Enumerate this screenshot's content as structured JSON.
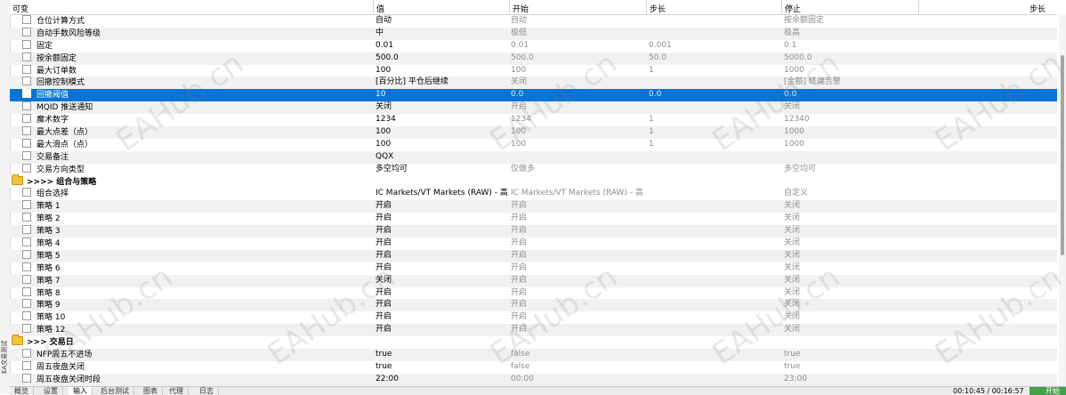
{
  "side_label": "EA交易测试",
  "columns": {
    "name": "可变",
    "value": "值",
    "start": "开始",
    "step": "步长",
    "stop": "停止",
    "step2": "步长"
  },
  "rows": [
    {
      "name": "仓位计算方式",
      "value": "自动",
      "start": "自动",
      "step": "",
      "stop": "按余额固定"
    },
    {
      "name": "自动手数风险等级",
      "value": "中",
      "start": "极低",
      "step": "",
      "stop": "极高"
    },
    {
      "name": "固定",
      "value": "0.01",
      "start": "0.01",
      "step": "0.001",
      "stop": "0.1"
    },
    {
      "name": "按余额固定",
      "value": "500.0",
      "start": "500.0",
      "step": "50.0",
      "stop": "5000.0"
    },
    {
      "name": "最大订单数",
      "value": "100",
      "start": "100",
      "step": "1",
      "stop": "1000"
    },
    {
      "name": "回撤控制模式",
      "value": "[百分比] 平仓后继续",
      "start": "关闭",
      "step": "",
      "stop": "[金额] 终端告警"
    },
    {
      "name": "回撤阈值",
      "value": "10",
      "start": "0.0",
      "step": "0.0",
      "stop": "0.0",
      "selected": true
    },
    {
      "name": "MQID 推送通知",
      "value": "关闭",
      "start": "开启",
      "step": "",
      "stop": "关闭"
    },
    {
      "name": "魔术数字",
      "value": "1234",
      "start": "1234",
      "step": "1",
      "stop": "12340"
    },
    {
      "name": "最大点差（点）",
      "value": "100",
      "start": "100",
      "step": "1",
      "stop": "1000"
    },
    {
      "name": "最大滑点（点）",
      "value": "100",
      "start": "100",
      "step": "1",
      "stop": "1000"
    },
    {
      "name": "交易备注",
      "value": "QQX",
      "start": "",
      "step": "",
      "stop": ""
    },
    {
      "name": "交易方向类型",
      "value": "多空均可",
      "start": "仅做多",
      "step": "",
      "stop": "多空均可"
    },
    {
      "name": ">>>> 组合与策略",
      "group": true
    },
    {
      "name": "组合选择",
      "value": "IC Markets/VT Markets (RAW) - 高...",
      "start": "IC Markets/VT Markets (RAW) - 高...",
      "step": "",
      "stop": "自定义"
    },
    {
      "name": "策略 1",
      "value": "开启",
      "start": "开启",
      "step": "",
      "stop": "关闭"
    },
    {
      "name": "策略 2",
      "value": "开启",
      "start": "开启",
      "step": "",
      "stop": "关闭"
    },
    {
      "name": "策略 3",
      "value": "开启",
      "start": "开启",
      "step": "",
      "stop": "关闭"
    },
    {
      "name": "策略 4",
      "value": "开启",
      "start": "开启",
      "step": "",
      "stop": "关闭"
    },
    {
      "name": "策略 5",
      "value": "开启",
      "start": "开启",
      "step": "",
      "stop": "关闭"
    },
    {
      "name": "策略 6",
      "value": "开启",
      "start": "开启",
      "step": "",
      "stop": "关闭"
    },
    {
      "name": "策略 7",
      "value": "关闭",
      "start": "开启",
      "step": "",
      "stop": "关闭"
    },
    {
      "name": "策略 8",
      "value": "开启",
      "start": "开启",
      "step": "",
      "stop": "关闭"
    },
    {
      "name": "策略 9",
      "value": "开启",
      "start": "开启",
      "step": "",
      "stop": "关闭"
    },
    {
      "name": "策略 10",
      "value": "开启",
      "start": "开启",
      "step": "",
      "stop": "关闭"
    },
    {
      "name": "策略 12",
      "value": "开启",
      "start": "开启",
      "step": "",
      "stop": "关闭"
    },
    {
      "name": ">>> 交易日",
      "group": true
    },
    {
      "name": "NFP周五不进场",
      "value": "true",
      "start": "false",
      "step": "",
      "stop": "true"
    },
    {
      "name": "周五夜盘关闭",
      "value": "true",
      "start": "false",
      "step": "",
      "stop": "true"
    },
    {
      "name": "周五夜盘关闭时段",
      "value": "22:00",
      "start": "00:00",
      "step": "",
      "stop": "23:00"
    }
  ],
  "tabs": [
    "概览",
    "设置",
    "输入",
    "后台测试",
    "图表",
    "代理",
    "日志"
  ],
  "active_tab": "输入",
  "timer": "00:10:45 / 00:16:57",
  "start_button": "开始",
  "watermark": "EAHub.cn"
}
